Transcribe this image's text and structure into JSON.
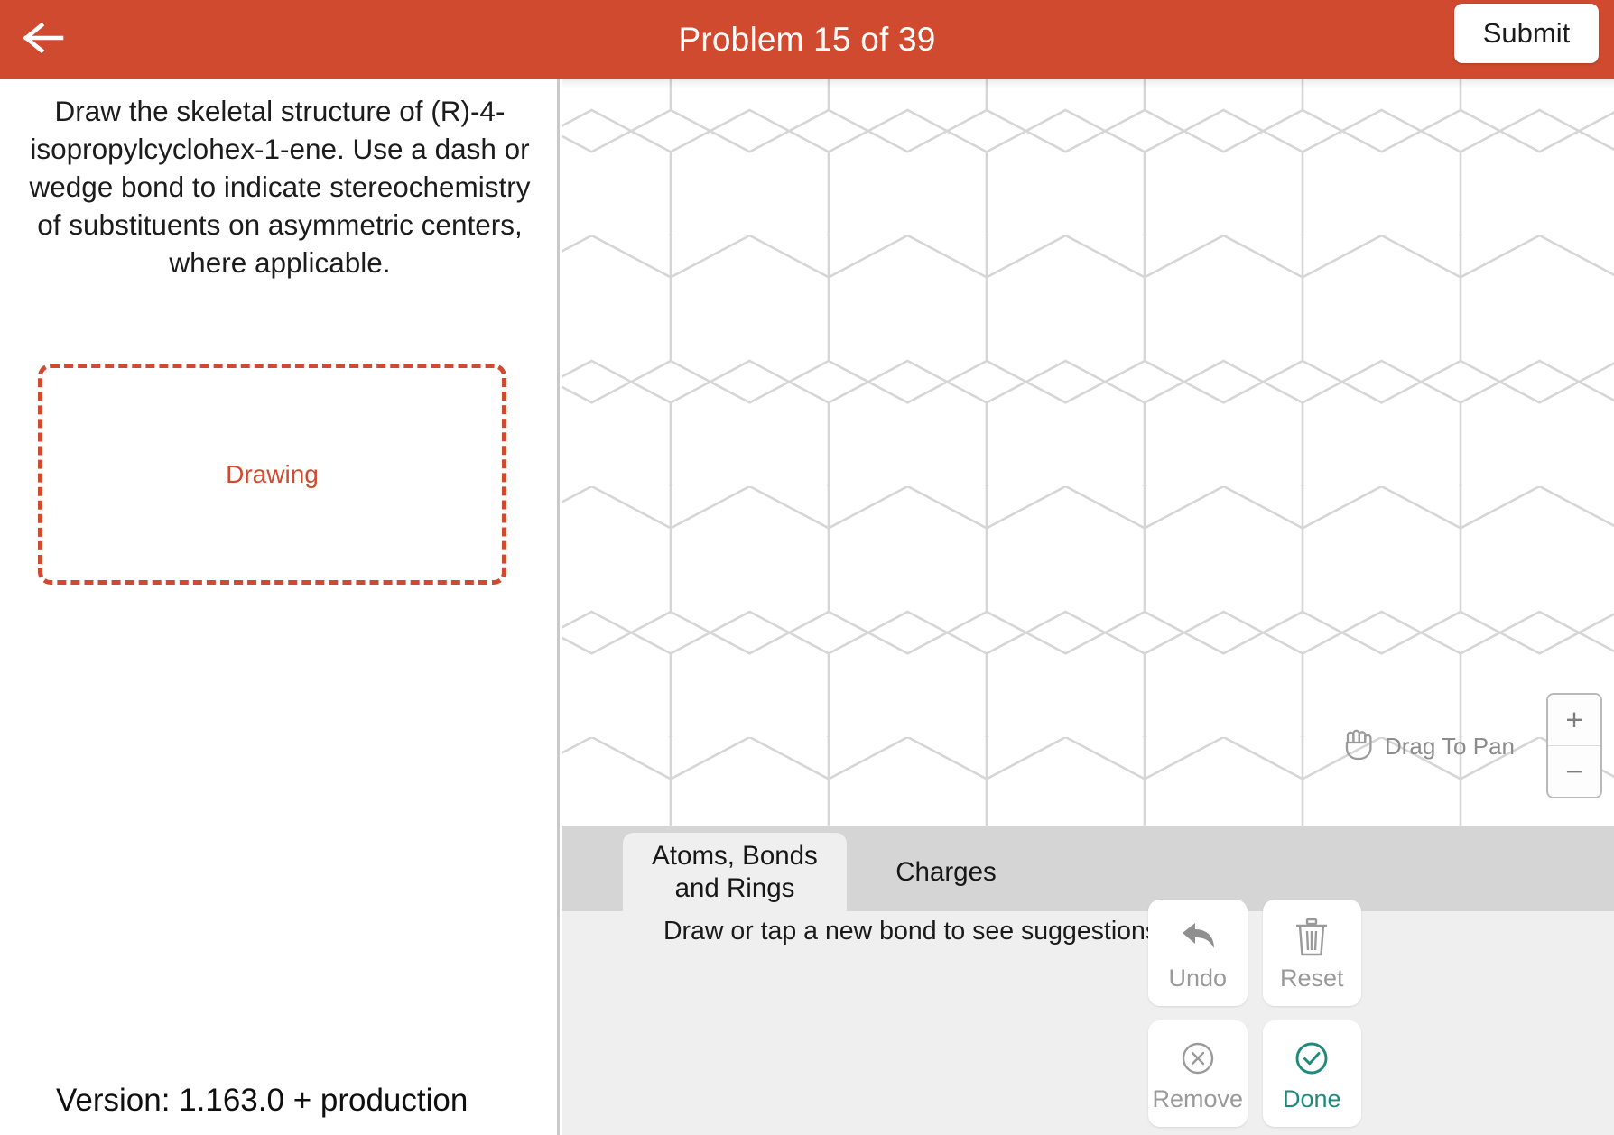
{
  "header": {
    "title": "Problem 15 of 39",
    "back_icon": "arrow-left-icon",
    "submit_label": "Submit"
  },
  "left_panel": {
    "problem_text": "Draw the skeletal structure of (R)-4-isopropylcyclohex-1-ene. Use a dash or wedge bond to indicate stereochemistry of substituents on asymmetric centers, where applicable.",
    "drawing_placeholder": "Drawing",
    "version": "Version: 1.163.0 +  production"
  },
  "canvas": {
    "pan_hint": "Drag To Pan",
    "pan_icon": "hand-icon",
    "zoom_in_label": "+",
    "zoom_out_label": "−",
    "hex_grid": {
      "hex_width": 175,
      "hex_height": 278,
      "line_color": "#d6d6d6"
    }
  },
  "tool_panel": {
    "tabs": [
      {
        "label": "Atoms, Bonds\nand Rings",
        "line1": "Atoms, Bonds",
        "line2": "and Rings",
        "active": true
      },
      {
        "label": "Charges",
        "active": false
      }
    ],
    "suggestion_text": "Draw or tap a new bond to see suggestions.",
    "actions": [
      {
        "label": "Undo",
        "icon": "undo-arrow-icon",
        "state": "disabled"
      },
      {
        "label": "Reset",
        "icon": "trash-icon",
        "state": "disabled"
      },
      {
        "label": "Remove",
        "icon": "circle-x-icon",
        "state": "disabled"
      },
      {
        "label": "Done",
        "icon": "circle-check-icon",
        "state": "enabled"
      }
    ]
  },
  "colors": {
    "brand_red": "#d04a2f",
    "panel_gray": "#efefef",
    "tab_strip_gray": "#d5d5d5",
    "done_green": "#1f8a7a",
    "disabled_gray": "#9a9a9a"
  }
}
